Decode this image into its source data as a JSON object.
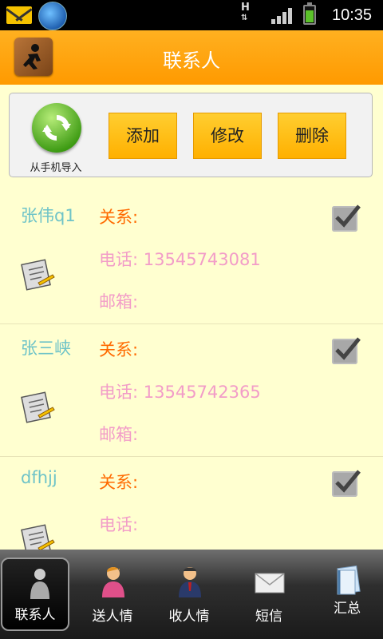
{
  "status_bar": {
    "network": "H",
    "time": "10:35"
  },
  "header": {
    "title": "联系人"
  },
  "actions": {
    "import_label": "从手机导入",
    "add": "添加",
    "edit": "修改",
    "delete": "删除"
  },
  "labels": {
    "relation": "关系:",
    "phone": "电话:",
    "email": "邮箱:"
  },
  "contacts": [
    {
      "name": "张伟q1",
      "relation": "",
      "phone": "13545743081",
      "email": "",
      "checked": true
    },
    {
      "name": "张三峡",
      "relation": "",
      "phone": "13545742365",
      "email": "",
      "checked": true
    },
    {
      "name": "dfhjj",
      "relation": "",
      "phone": "",
      "email": "",
      "checked": true
    }
  ],
  "nav": [
    {
      "label": "联系人",
      "icon": "contacts-icon",
      "active": true
    },
    {
      "label": "送人情",
      "icon": "give-gift-icon",
      "active": false
    },
    {
      "label": "收人情",
      "icon": "receive-gift-icon",
      "active": false
    },
    {
      "label": "短信",
      "icon": "envelope-icon",
      "active": false
    },
    {
      "label": "汇总",
      "icon": "notebook-icon",
      "active": false
    }
  ],
  "colors": {
    "accent": "#ff9a00",
    "name": "#6ec3c8",
    "relation": "#ff6a00",
    "field": "#f29cc8",
    "background": "#ffffd0"
  }
}
